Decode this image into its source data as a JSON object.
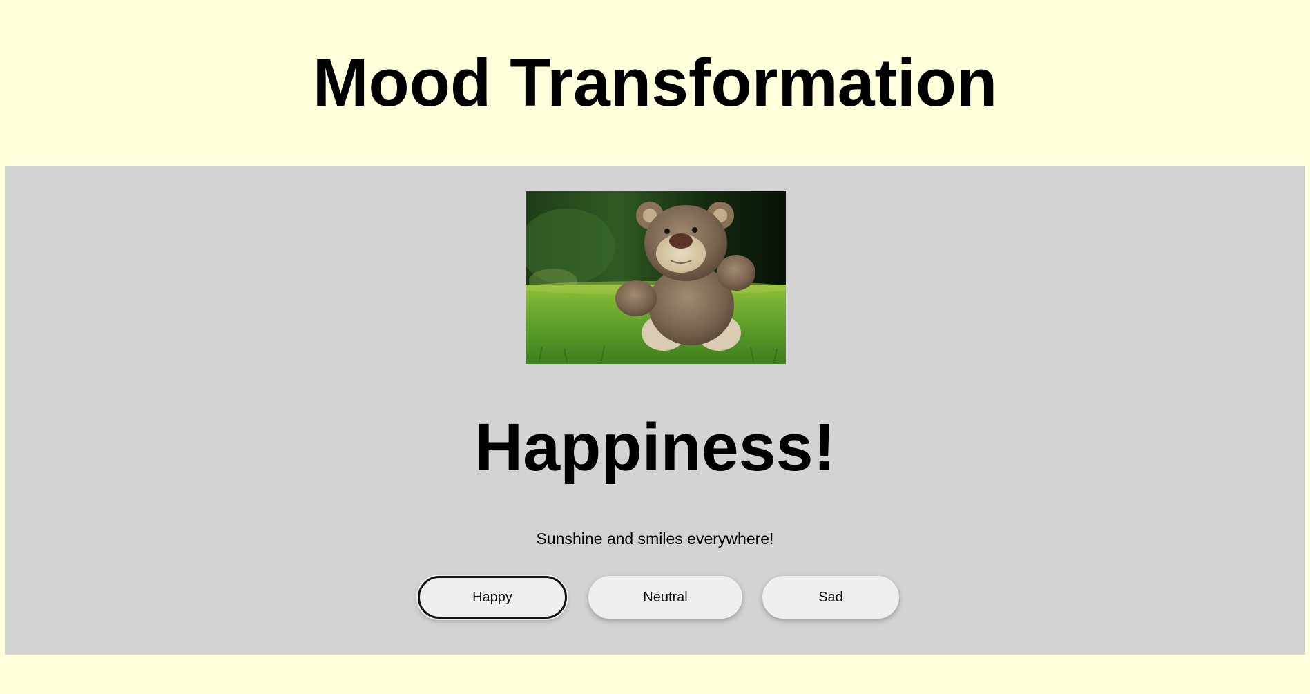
{
  "header": {
    "title": "Mood Transformation"
  },
  "main": {
    "image_alt": "Teddy bear sitting on grass",
    "mood_heading": "Happiness!",
    "mood_message": "Sunshine and smiles everywhere!",
    "buttons": [
      {
        "label": "Happy",
        "active": true
      },
      {
        "label": "Neutral",
        "active": false
      },
      {
        "label": "Sad",
        "active": false
      }
    ]
  },
  "colors": {
    "page_background": "#ffffdc",
    "panel_background": "#d3d3d3",
    "button_background": "#efefef",
    "active_outline": "#111111"
  },
  "icons": {
    "photo": "teddy-bear-photo"
  }
}
